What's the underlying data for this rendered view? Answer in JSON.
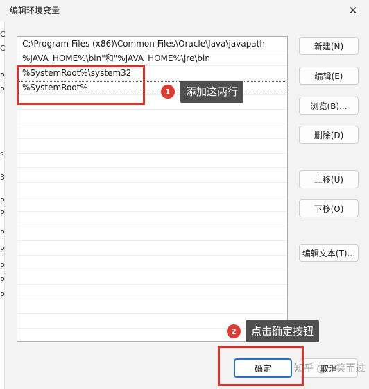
{
  "window": {
    "title": "编辑环境变量",
    "close_glyph": "✕"
  },
  "left_strip_chars": [
    "C",
    "C",
    "P",
    "P",
    "s",
    "3",
    "P",
    "P",
    "P",
    "P",
    "P",
    "P",
    "P"
  ],
  "list": {
    "rows": [
      "C:\\Program Files (x86)\\Common Files\\Oracle\\Java\\javapath",
      "%JAVA_HOME%\\bin\"和\"%JAVA_HOME%\\jre\\bin",
      "%SystemRoot%\\system32",
      "%SystemRoot%"
    ],
    "empty_row_count": 16
  },
  "buttons": {
    "new": "新建(N)",
    "edit": "编辑(E)",
    "browse": "浏览(B)...",
    "delete": "删除(D)",
    "move_up": "上移(U)",
    "move_down": "下移(O)",
    "edit_text": "编辑文本(T)...",
    "ok": "确定",
    "cancel": "取消"
  },
  "annotations": {
    "step1_number": "1",
    "step1_text": "添加这两行",
    "step2_number": "2",
    "step2_text": "点击确定按钮",
    "accent_red": "#d9342b"
  },
  "watermark": "知乎 @一笑而过"
}
